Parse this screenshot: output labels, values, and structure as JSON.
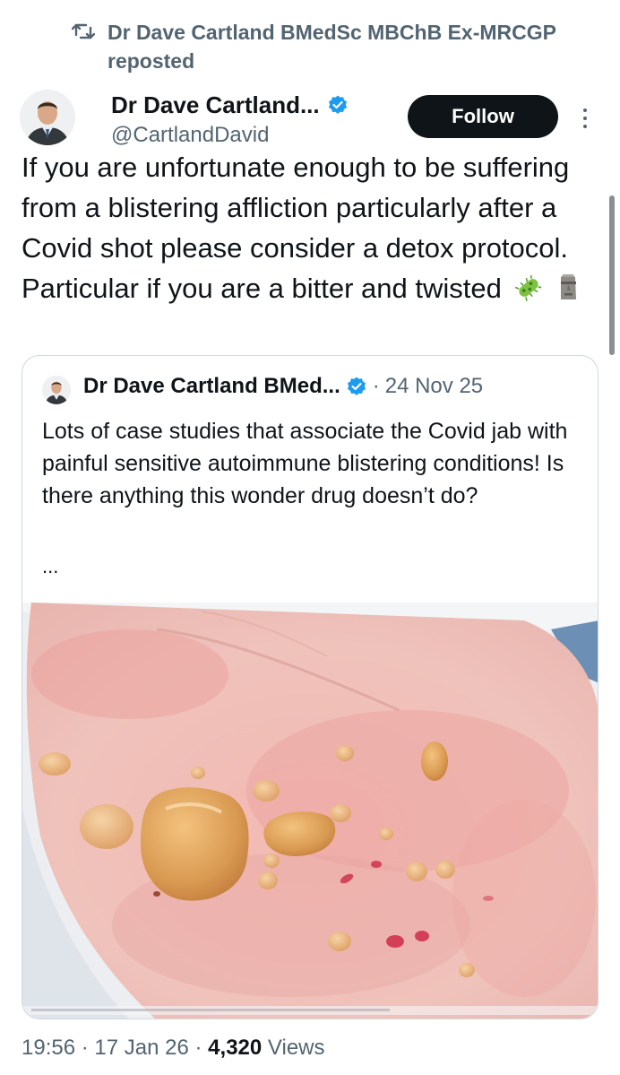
{
  "repost": {
    "icon": "repost-icon",
    "text": "Dr Dave Cartland BMedSc MBChB Ex-MRCGP reposted"
  },
  "post": {
    "author_name": "Dr Dave Cartland...",
    "handle": "@CartlandDavid",
    "follow_label": "Follow",
    "text": "If you are unfortunate enough to be suffering from a blistering affliction particularly after a Covid shot please consider a detox protocol. Particular if you are a bitter and twisted",
    "emojis": [
      "microbe-emoji",
      "moai-emoji"
    ]
  },
  "quote": {
    "author_name": "Dr Dave Cartland BMed...",
    "separator": "·",
    "date": "24 Nov 25",
    "text": "Lots of case studies that associate the Covid jab with painful sensitive autoimmune blistering conditions! Is there anything this wonder drug doesn’t do?",
    "ellipsis": "..."
  },
  "meta": {
    "time": "19:56",
    "sep1": "·",
    "date": "17 Jan 26",
    "sep2": "·",
    "views_count": "4,320",
    "views_label": "Views"
  },
  "colors": {
    "text_primary": "#0f1419",
    "text_secondary": "#536471",
    "verified_blue": "#1d9bf0",
    "border": "#cfd9de",
    "follow_bg": "#0f1419"
  }
}
